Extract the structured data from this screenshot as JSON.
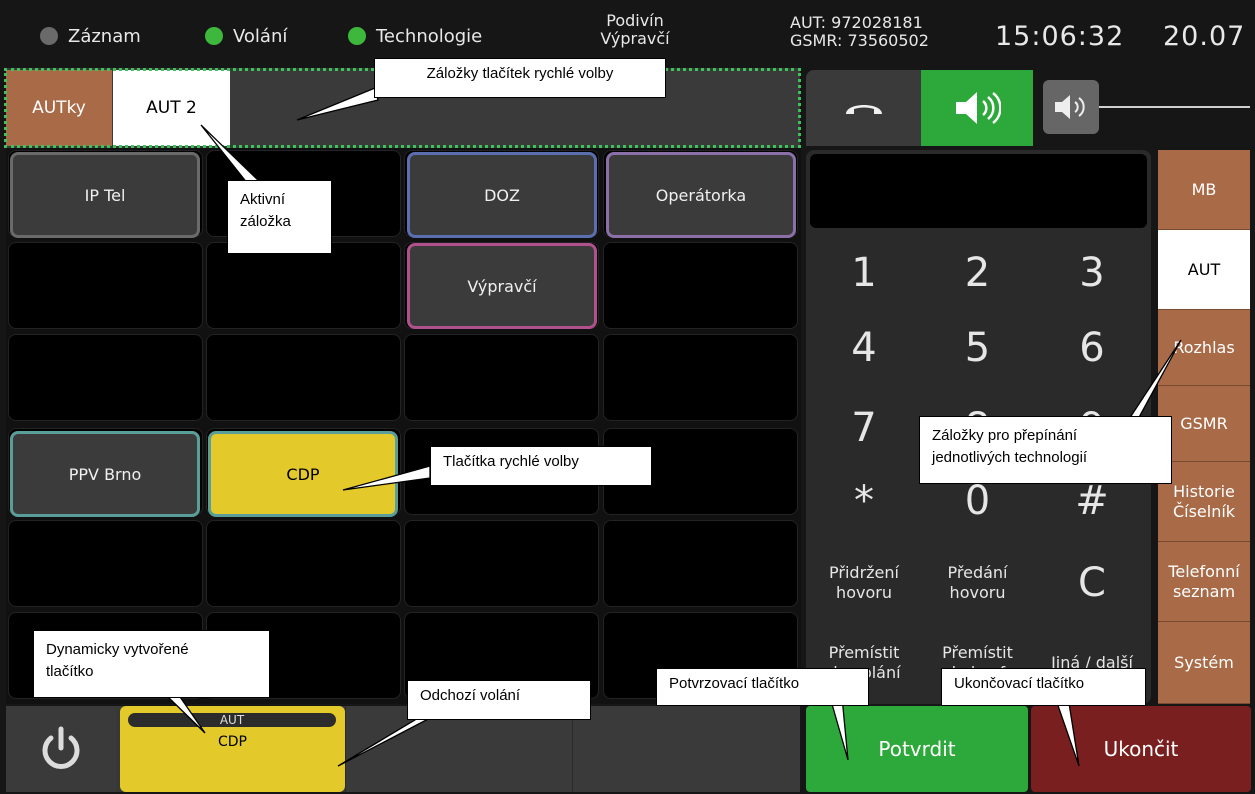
{
  "status": {
    "indicators": [
      {
        "label": "Záznam",
        "color": "#6a6a6a"
      },
      {
        "label": "Volání",
        "color": "#3db83d"
      },
      {
        "label": "Technologie",
        "color": "#3db83d"
      }
    ],
    "location_line1": "Podivín",
    "location_line2": "Výpravčí",
    "aut_number": "AUT: 972028181",
    "gsmr_number": "GSMR: 73560502",
    "time": "15:06:32",
    "date": "20.07"
  },
  "tabs": [
    {
      "label": "AUTky",
      "state": "inactive"
    },
    {
      "label": "AUT 2",
      "state": "active"
    },
    {
      "label": ""
    },
    {
      "label": ""
    },
    {
      "label": ""
    },
    {
      "label": ""
    }
  ],
  "quick_buttons": [
    {
      "label": "IP Tel",
      "border": "#6a6a6a"
    },
    {
      "label": "DOZ",
      "border": "#5b6eae"
    },
    {
      "label": "Operátorka",
      "border": "#8a6fa8"
    },
    {
      "label": "Výpravčí",
      "border": "#b0508c"
    },
    {
      "label": "PPV Brno",
      "border": "#5a9e9a"
    },
    {
      "label": "CDP",
      "border": "#5a9e9a",
      "fill": "#e3c92a"
    }
  ],
  "bottom_bar": {
    "power_icon": "power-icon",
    "outgoing_tag": "AUT",
    "outgoing_label": "CDP"
  },
  "audio": {
    "handset_icon": "hangup-icon",
    "speaker_icon": "speaker-icon",
    "volume_icon": "volume-icon"
  },
  "keypad": {
    "display_value": "",
    "keys": [
      "1",
      "2",
      "3",
      "4",
      "5",
      "6",
      "7",
      "8",
      "9",
      "*",
      "0",
      "#"
    ],
    "hold_label": "Přidržení hovoru",
    "transfer_label": "Předání hovoru",
    "clear_label": "C",
    "move_call_label": "Přemístit do volání",
    "move_conf_label": "Přemístit do konf.",
    "other_label": "Jiná / další"
  },
  "side_tabs": [
    {
      "label": "MB"
    },
    {
      "label": "AUT"
    },
    {
      "label": "Rozhlas"
    },
    {
      "label": "GSMR"
    },
    {
      "label": "Historie Číselník"
    },
    {
      "label": "Telefonní seznam"
    },
    {
      "label": "Systém"
    }
  ],
  "actions": {
    "confirm_label": "Potvrdit",
    "end_label": "Ukončit"
  },
  "colors": {
    "accent_green": "#2da83a",
    "end_red": "#7a1f1f",
    "tab_brown": "#a86a47",
    "cdp_yellow": "#e3c92a"
  },
  "annotations": {
    "tabs_quick": "Záložky tlačítek rychlé volby",
    "active_tab_l1": "Aktivní",
    "active_tab_l2": "záložka",
    "quick_buttons": "Tlačítka rychlé volby",
    "tech_tabs_l1": "Záložky pro přepínání",
    "tech_tabs_l2": "jednotlivých technologií",
    "dynamic_l1": "Dynamicky vytvořené",
    "dynamic_l2": "tlačítko",
    "outgoing": "Odchozí volání",
    "confirm": "Potvrzovací tlačítko",
    "end": "Ukončovací tlačítko"
  }
}
